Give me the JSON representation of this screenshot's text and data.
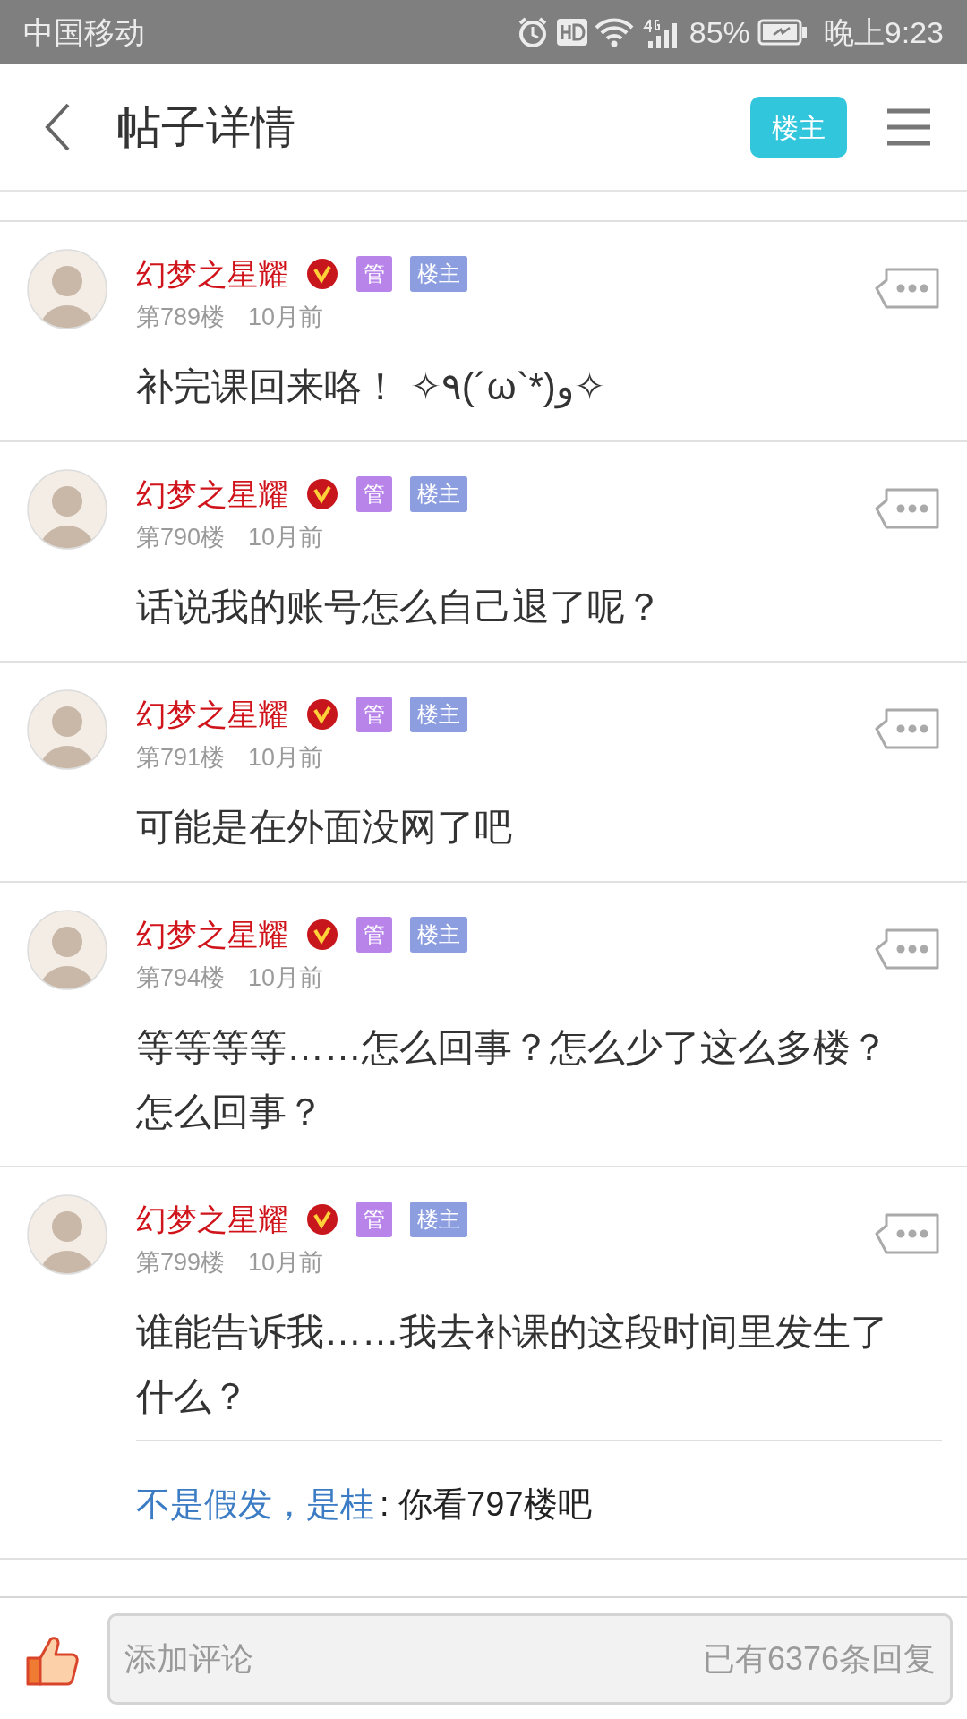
{
  "status_bar": {
    "carrier": "中国移动",
    "battery": "85%",
    "time": "晚上9:23"
  },
  "header": {
    "title": "帖子详情",
    "op_button": "楼主"
  },
  "posts": [
    {
      "author": "幻梦之星耀",
      "badges": [
        {
          "label": "管",
          "color": "#b884ea"
        },
        {
          "label": "楼主",
          "color": "#8c9ee0"
        }
      ],
      "floor": "第789楼",
      "time": "10月前",
      "content": "补完课回来咯！ ✧٩(´ω`*)و✧"
    },
    {
      "author": "幻梦之星耀",
      "badges": [
        {
          "label": "管",
          "color": "#b884ea"
        },
        {
          "label": "楼主",
          "color": "#8c9ee0"
        }
      ],
      "floor": "第790楼",
      "time": "10月前",
      "content": "话说我的账号怎么自己退了呢？"
    },
    {
      "author": "幻梦之星耀",
      "badges": [
        {
          "label": "管",
          "color": "#b884ea"
        },
        {
          "label": "楼主",
          "color": "#8c9ee0"
        }
      ],
      "floor": "第791楼",
      "time": "10月前",
      "content": "可能是在外面没网了吧"
    },
    {
      "author": "幻梦之星耀",
      "badges": [
        {
          "label": "管",
          "color": "#b884ea"
        },
        {
          "label": "楼主",
          "color": "#8c9ee0"
        }
      ],
      "floor": "第794楼",
      "time": "10月前",
      "content": "等等等等……怎么回事？怎么少了这么多楼？怎么回事？"
    },
    {
      "author": "幻梦之星耀",
      "badges": [
        {
          "label": "管",
          "color": "#b884ea"
        },
        {
          "label": "楼主",
          "color": "#8c9ee0"
        }
      ],
      "floor": "第799楼",
      "time": "10月前",
      "content": "谁能告诉我……我去补课的这段时间里发生了什么？",
      "replies": [
        {
          "author": "不是假发，是桂",
          "text": ": 你看797楼吧"
        }
      ]
    }
  ],
  "bottom_bar": {
    "placeholder": "添加评论",
    "reply_count": "已有6376条回复"
  }
}
